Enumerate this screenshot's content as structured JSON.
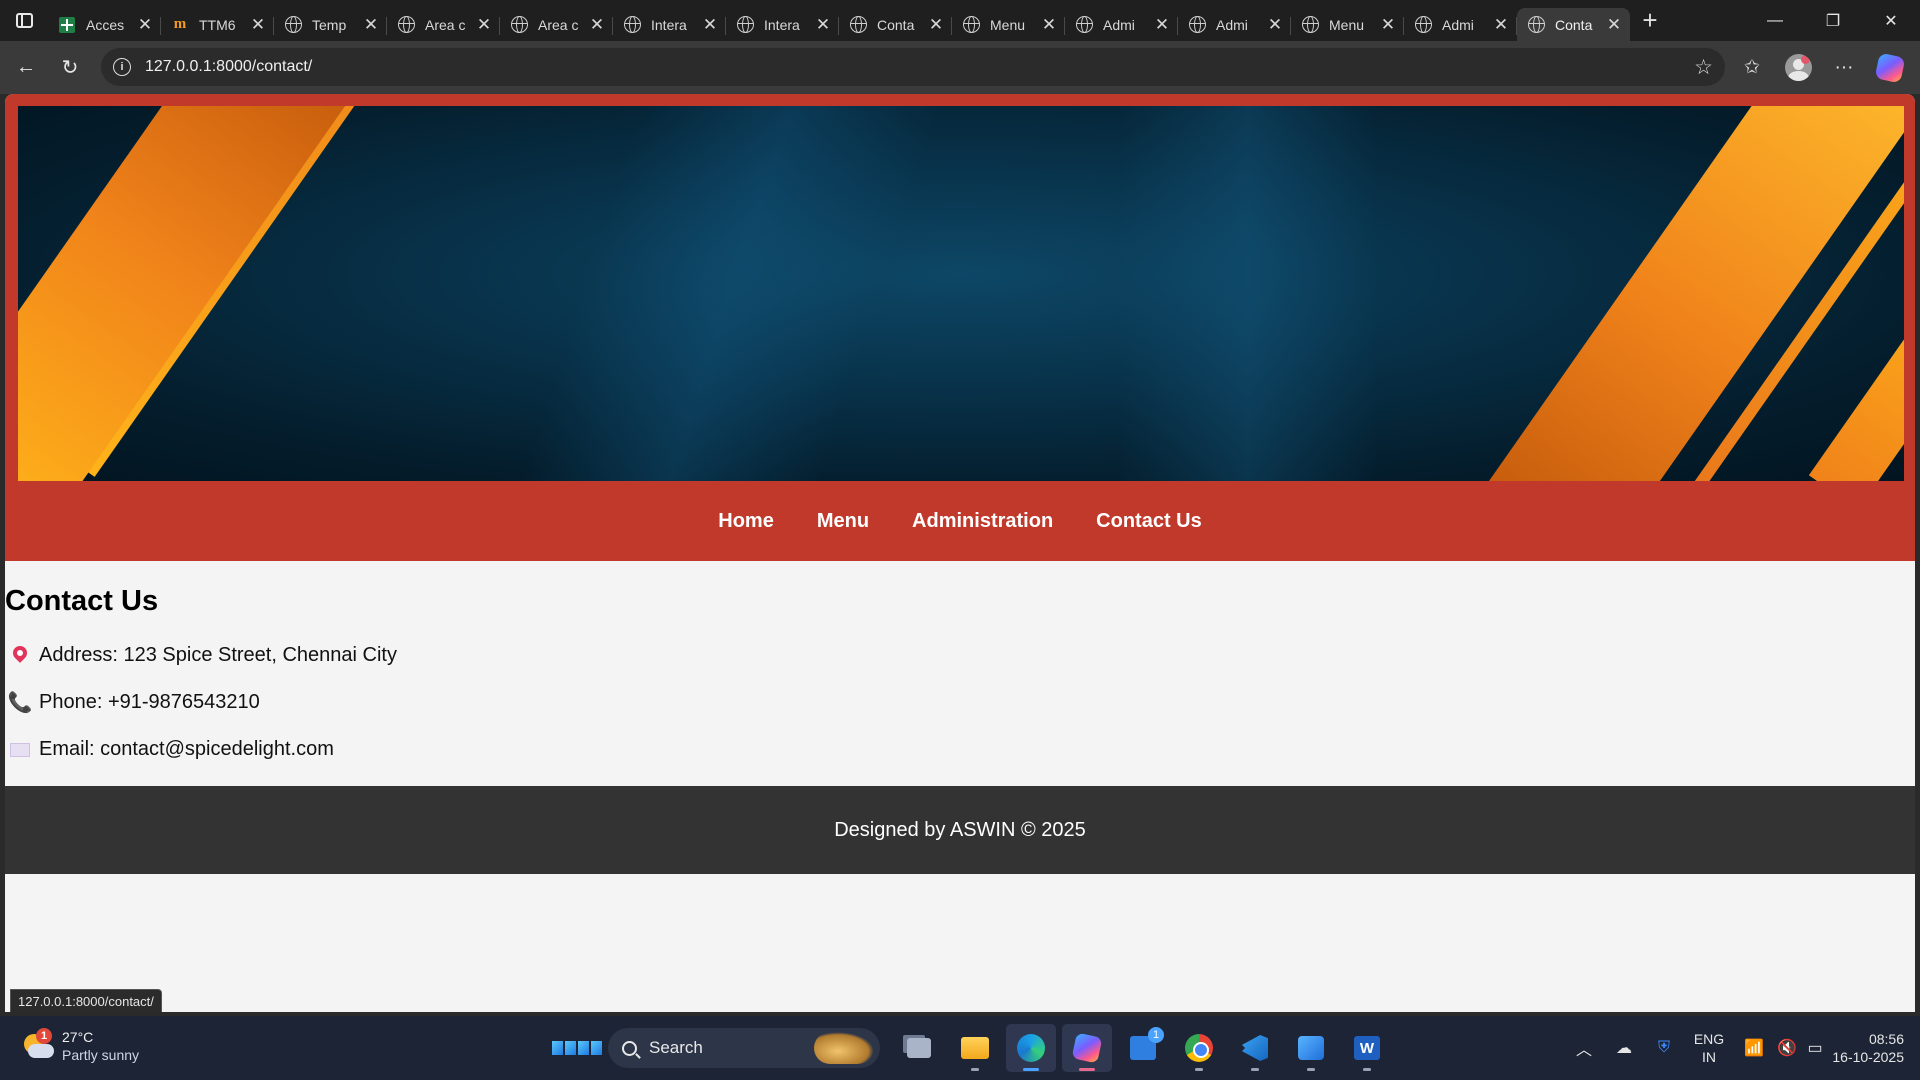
{
  "browser": {
    "tabs": [
      {
        "title": "Acces",
        "icon": "sheet-icon",
        "active": false
      },
      {
        "title": "TTM6",
        "icon": "m-logo-icon",
        "active": false
      },
      {
        "title": "Temp",
        "icon": "globe-icon",
        "active": false
      },
      {
        "title": "Area c",
        "icon": "globe-icon",
        "active": false
      },
      {
        "title": "Area c",
        "icon": "globe-icon",
        "active": false
      },
      {
        "title": "Intera",
        "icon": "globe-icon",
        "active": false
      },
      {
        "title": "Intera",
        "icon": "globe-icon",
        "active": false
      },
      {
        "title": "Conta",
        "icon": "globe-icon",
        "active": false
      },
      {
        "title": "Menu",
        "icon": "globe-icon",
        "active": false
      },
      {
        "title": "Admi",
        "icon": "globe-icon",
        "active": false
      },
      {
        "title": "Admi",
        "icon": "globe-icon",
        "active": false
      },
      {
        "title": "Menu",
        "icon": "globe-icon",
        "active": false
      },
      {
        "title": "Admi",
        "icon": "globe-icon",
        "active": false
      },
      {
        "title": "Conta",
        "icon": "globe-icon",
        "active": true
      }
    ],
    "url": "127.0.0.1:8000/contact/",
    "status_url": "127.0.0.1:8000/contact/"
  },
  "site": {
    "nav": {
      "home": "Home",
      "menu": "Menu",
      "administration": "Administration",
      "contact": "Contact Us"
    },
    "contact": {
      "heading": "Contact Us",
      "address": "Address: 123 Spice Street, Chennai City",
      "phone": "Phone: +91-9876543210",
      "email": "Email: contact@spicedelight.com"
    },
    "footer": "Designed by ASWIN © 2025",
    "colors": {
      "header_bg": "#c0392b",
      "footer_bg": "#333333",
      "page_bg": "#f4f4f4"
    }
  },
  "taskbar": {
    "weather": {
      "temp": "27°C",
      "condition": "Partly sunny",
      "badge": "1"
    },
    "search_placeholder": "Search",
    "store_badge": "1",
    "word_letter": "W",
    "language": {
      "line1": "ENG",
      "line2": "IN"
    },
    "clock": {
      "time": "08:56",
      "date": "16-10-2025"
    }
  }
}
